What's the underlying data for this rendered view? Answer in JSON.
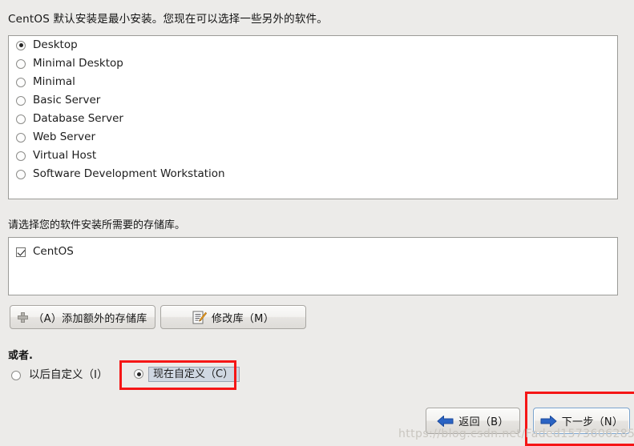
{
  "intro": {
    "text": "CentOS 默认安装是最小安装。您现在可以选择一些另外的软件。"
  },
  "install_groups": {
    "options": [
      {
        "label": "Desktop",
        "selected": true
      },
      {
        "label": "Minimal Desktop",
        "selected": false
      },
      {
        "label": "Minimal",
        "selected": false
      },
      {
        "label": "Basic Server",
        "selected": false
      },
      {
        "label": "Database Server",
        "selected": false
      },
      {
        "label": "Web Server",
        "selected": false
      },
      {
        "label": "Virtual Host",
        "selected": false
      },
      {
        "label": "Software Development Workstation",
        "selected": false
      }
    ]
  },
  "repository": {
    "label": "请选择您的软件安装所需要的存储库。",
    "items": [
      {
        "label": "CentOS",
        "checked": true
      }
    ],
    "add_button": {
      "label": "（A）添加额外的存储库",
      "icon": "plus-icon"
    },
    "modify_button": {
      "label": "修改库（M）",
      "icon": "document-pencil-icon"
    }
  },
  "customize": {
    "or_label": "或者.",
    "later": {
      "label": "以后自定义（I）",
      "selected": false
    },
    "now": {
      "label": "现在自定义（C）",
      "selected": true
    }
  },
  "navigation": {
    "back": {
      "label": "返回（B）",
      "icon": "arrow-left-icon"
    },
    "next": {
      "label": "下一步（N）",
      "icon": "arrow-right-icon"
    }
  },
  "watermark": {
    "text": "https://blog.csdn.net/Faded1573606285"
  },
  "colors": {
    "background": "#ecebe9",
    "panel": "#ffffff",
    "panel_border": "#9b9b97",
    "annotation_red": "#f51616",
    "arrow_blue": "#2b64c4",
    "focus_chip": "#cfd7e2",
    "watermark": "#c9c6c0"
  }
}
